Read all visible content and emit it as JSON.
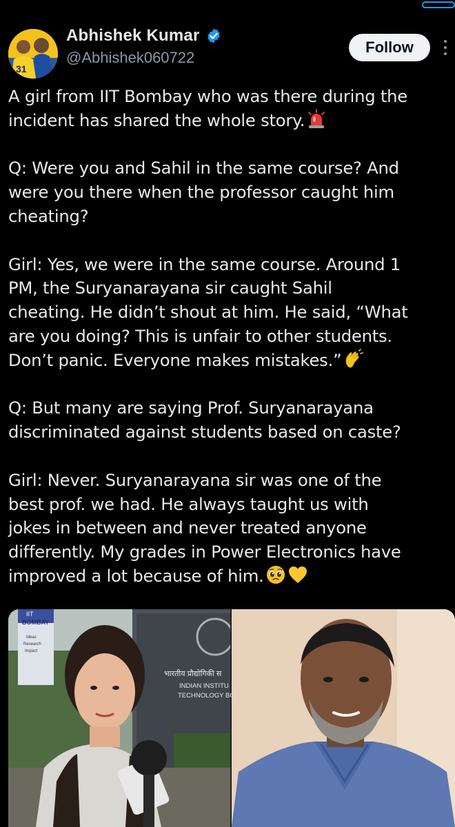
{
  "profile": {
    "display_name": "Abhishek Kumar",
    "handle": "@Abhishek060722",
    "verified": true,
    "avatar_jersey_number": "31",
    "follow_label": "Follow"
  },
  "colors": {
    "background": "#000000",
    "text": "#e7e9ea",
    "secondary_text": "#8b98a5",
    "verified_badge": "#1d9bf0",
    "follow_button": "#eff3f4"
  },
  "tweet": {
    "paragraphs": [
      {
        "lines": [
          "A girl from IIT Bombay who was there during the",
          "incident has shared the whole story."
        ],
        "emoji": [
          "police-light-emoji"
        ]
      },
      {
        "lines": [
          "Q: Were you and Sahil in the same course? And",
          "were you there when the professor caught him",
          "cheating?"
        ],
        "emoji": []
      },
      {
        "lines": [
          "Girl: Yes, we were in the same course. Around 1",
          "PM, the Suryanarayana sir caught Sahil",
          "cheating. He didn’t shout at him. He said, “What",
          "are you doing? This is unfair to other students.",
          "Don’t panic. Everyone makes mistakes.”"
        ],
        "emoji": [
          "clapping-hands-emoji"
        ]
      },
      {
        "lines": [
          "Q: But many are saying Prof. Suryanarayana",
          "discriminated against students based on caste?"
        ],
        "emoji": []
      },
      {
        "lines": [
          "Girl: Never. Suryanarayana sir was one of the",
          "best prof. we had. He always taught us with",
          "jokes in between and never treated anyone",
          "differently. My grades in Power Electronics have",
          "improved a lot because of him."
        ],
        "emoji": [
          "pleading-face-emoji",
          "yellow-heart-emoji"
        ]
      }
    ]
  },
  "media": {
    "left_photo": {
      "sign_top": "IIT",
      "sign_name": "BOMBAY",
      "sign_tagline": [
        "Ideas",
        "Research",
        "Impact"
      ],
      "building_sign_hindi": "भारतीय प्रौद्योगिकी स",
      "building_sign_line1": "INDIAN INSTITU",
      "building_sign_line2": "TECHNOLOGY BO"
    },
    "right_photo": {}
  }
}
